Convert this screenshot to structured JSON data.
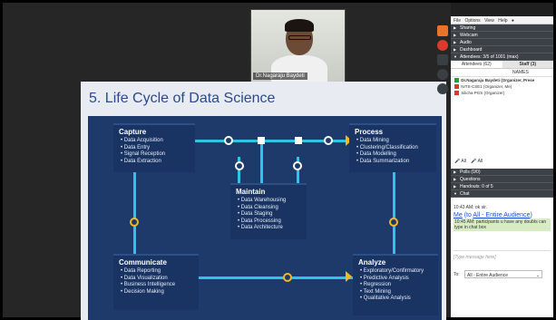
{
  "presenter": {
    "name": "Dr.Nagaraju Baydeti"
  },
  "slide": {
    "title": "5. Life Cycle of Data Science",
    "capture": {
      "heading": "Capture",
      "items": [
        "Data Acquisition",
        "Data Entry",
        "Signal Reception",
        "Data Extraction"
      ]
    },
    "process": {
      "heading": "Process",
      "items": [
        "Data Mining",
        "Clustering/Classification",
        "Data Modelling",
        "Data Summarization"
      ]
    },
    "maintain": {
      "heading": "Maintain",
      "items": [
        "Data Warehousing",
        "Data Cleansing",
        "Data Staging",
        "Data Processing",
        "Data Architecture"
      ]
    },
    "communicate": {
      "heading": "Communicate",
      "items": [
        "Data Reporting",
        "Data Visualization",
        "Business Intelligence",
        "Decision Making"
      ]
    },
    "analyze": {
      "heading": "Analyze",
      "items": [
        "Exploratory/Confirmatory",
        "Predictive Analysis",
        "Regression",
        "Text Mining",
        "Qualitative Analysis"
      ]
    }
  },
  "panel": {
    "menu": [
      "File",
      "Options",
      "View",
      "Help"
    ],
    "sections": [
      "Sharing",
      "Webcam",
      "Audio",
      "Dashboard"
    ],
    "attendees_label": "Attendees: 3/5 of 1001 (max)",
    "tabs": [
      "Attendees (62)",
      "Staff (3)"
    ],
    "names_header": "NAMES",
    "staff": [
      "Dr.Nagaraju Baydeti (Organizer, Prese",
      "NITS-CSE1 (Organizer, Me)",
      "Silicha PGS (Organizer)"
    ],
    "mute_all": "All",
    "unmute_all": "All",
    "lower": [
      "Polls (0/0)",
      "Questions",
      "Handouts: 0 of 5"
    ],
    "chat_section": "Chat",
    "chat1": "10:43 AM: ok sir.",
    "chat_me": "Me",
    "chat_to": "All - Entire Audience",
    "chat2": "10:45 AM: participants u have any doubts can type in chat box",
    "message_placeholder": "[Type message here]",
    "to_label": "To:",
    "to_value": "All - Entire Audience"
  }
}
